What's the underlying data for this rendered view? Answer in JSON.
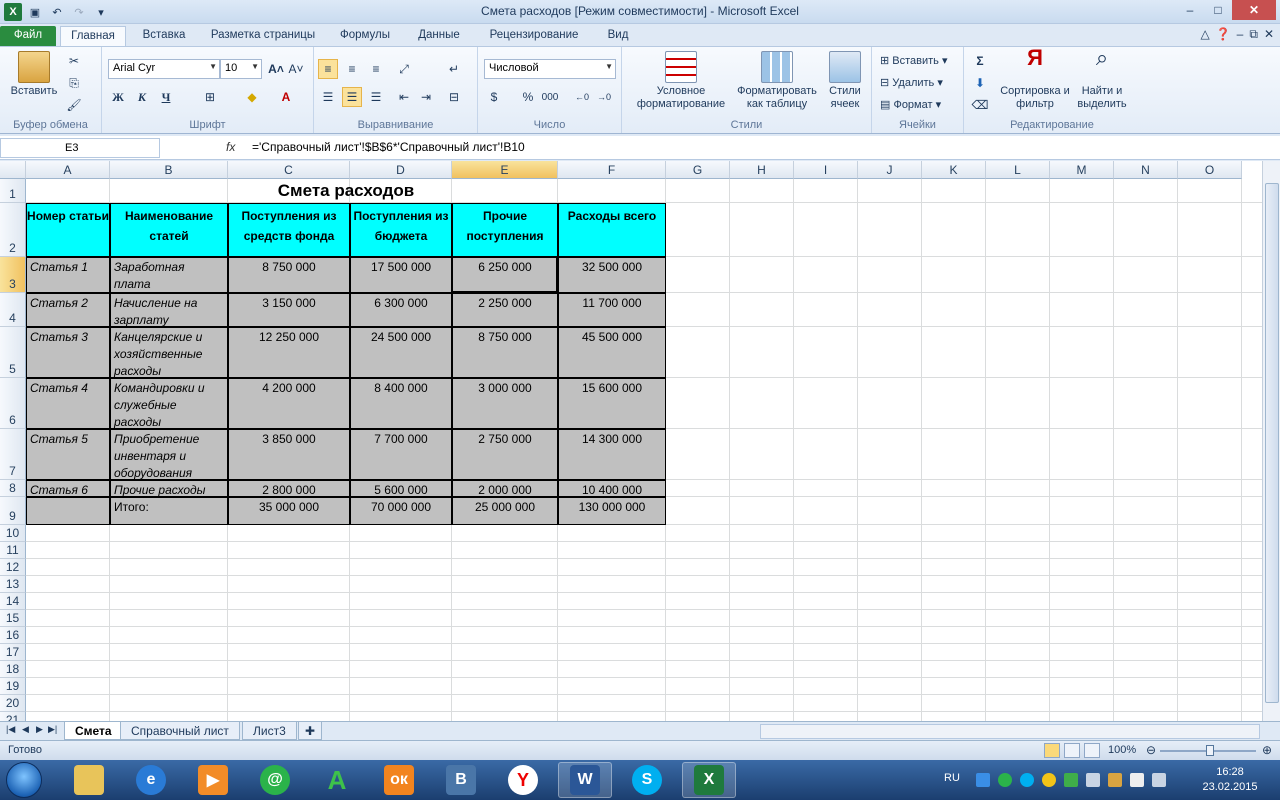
{
  "window": {
    "title": "Смета расходов  [Режим совместимости]  -  Microsoft Excel",
    "controls": [
      "–",
      "□",
      "✕"
    ]
  },
  "ribbon_tabs": [
    "Файл",
    "Главная",
    "Вставка",
    "Разметка страницы",
    "Формулы",
    "Данные",
    "Рецензирование",
    "Вид"
  ],
  "ribbon": {
    "clipboard": {
      "paste": "Вставить",
      "title": "Буфер обмена"
    },
    "font": {
      "name": "Arial Cyr",
      "size": "10",
      "bold": "Ж",
      "italic": "К",
      "underline": "Ч",
      "title": "Шрифт"
    },
    "alignment": {
      "title": "Выравнивание"
    },
    "number": {
      "format": "Числовой",
      "currency": "$",
      "percent": "%",
      "thousands": "000",
      "title": "Число"
    },
    "styles": {
      "conditional": "Условное форматирование",
      "as_table": "Форматировать как таблицу",
      "cell_styles": "Стили ячеек",
      "title": "Стили"
    },
    "cells": {
      "insert": "Вставить",
      "delete": "Удалить",
      "format": "Формат",
      "title": "Ячейки"
    },
    "editing": {
      "sort": "Сортировка и фильтр",
      "find": "Найти и выделить",
      "title": "Редактирование"
    }
  },
  "formula_bar": {
    "name_box": "E3",
    "fx": "fx",
    "formula": "='Справочный лист'!$B$6*'Справочный лист'!B10"
  },
  "columns": [
    "A",
    "B",
    "C",
    "D",
    "E",
    "F",
    "G",
    "H",
    "I",
    "J",
    "K",
    "L",
    "M",
    "N",
    "O"
  ],
  "rows": [
    "1",
    "2",
    "3",
    "4",
    "5",
    "6",
    "7",
    "8",
    "9",
    "10",
    "11",
    "12",
    "13",
    "14",
    "15",
    "16",
    "17",
    "18",
    "19",
    "20",
    "21"
  ],
  "sheet": {
    "title": "Смета расходов",
    "headers": [
      "Номер статьи",
      "Наименование статей",
      "Поступления из средств фонда",
      "Поступления из бюджета",
      "Прочие поступления",
      "Расходы всего"
    ],
    "data": [
      [
        "Статья 1",
        "Заработная плата",
        "8 750 000",
        "17 500 000",
        "6 250 000",
        "32 500 000"
      ],
      [
        "Статья 2",
        "Начисление на зарплату",
        "3 150 000",
        "6 300 000",
        "2 250 000",
        "11 700 000"
      ],
      [
        "Статья 3",
        "Канцелярские и хозяйственные расходы",
        "12 250 000",
        "24 500 000",
        "8 750 000",
        "45 500 000"
      ],
      [
        "Статья 4",
        "Командировки и служебные расходы",
        "4 200 000",
        "8 400 000",
        "3 000 000",
        "15 600 000"
      ],
      [
        "Статья 5",
        "Приобретение инвентаря и оборудования",
        "3 850 000",
        "7 700 000",
        "2 750 000",
        "14 300 000"
      ],
      [
        "Статья 6",
        "Прочие расходы",
        "2 800 000",
        "5 600 000",
        "2 000 000",
        "10 400 000"
      ],
      [
        "",
        "Итого:",
        "35 000 000",
        "70 000 000",
        "25 000 000",
        "130 000 000"
      ]
    ]
  },
  "sheet_tabs": [
    "Смета",
    "Справочный лист",
    "Лист3"
  ],
  "status": {
    "ready": "Готово",
    "zoom": "100%"
  },
  "taskbar": {
    "lang": "RU",
    "time": "16:28",
    "date": "23.02.2015"
  }
}
